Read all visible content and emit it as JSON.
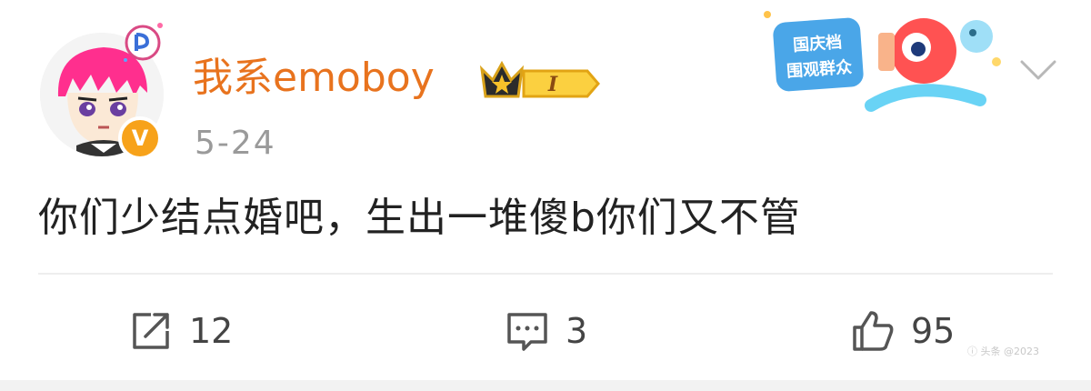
{
  "post": {
    "username": "我系emoboy",
    "level_badge": "I",
    "verified_mark": "V",
    "date": "5-24",
    "text": "你们少结点婚吧，生出一堆傻b你们又不管",
    "sticker_lines": [
      "国庆档",
      "围观群众"
    ],
    "actions": {
      "repost_count": "12",
      "comment_count": "3",
      "like_count": "95"
    },
    "watermark": "ⓘ 头条 @2023"
  },
  "colors": {
    "username": "#e8731e",
    "verified": "#f7a21a",
    "text": "#222222",
    "muted": "#9a9a9a"
  }
}
